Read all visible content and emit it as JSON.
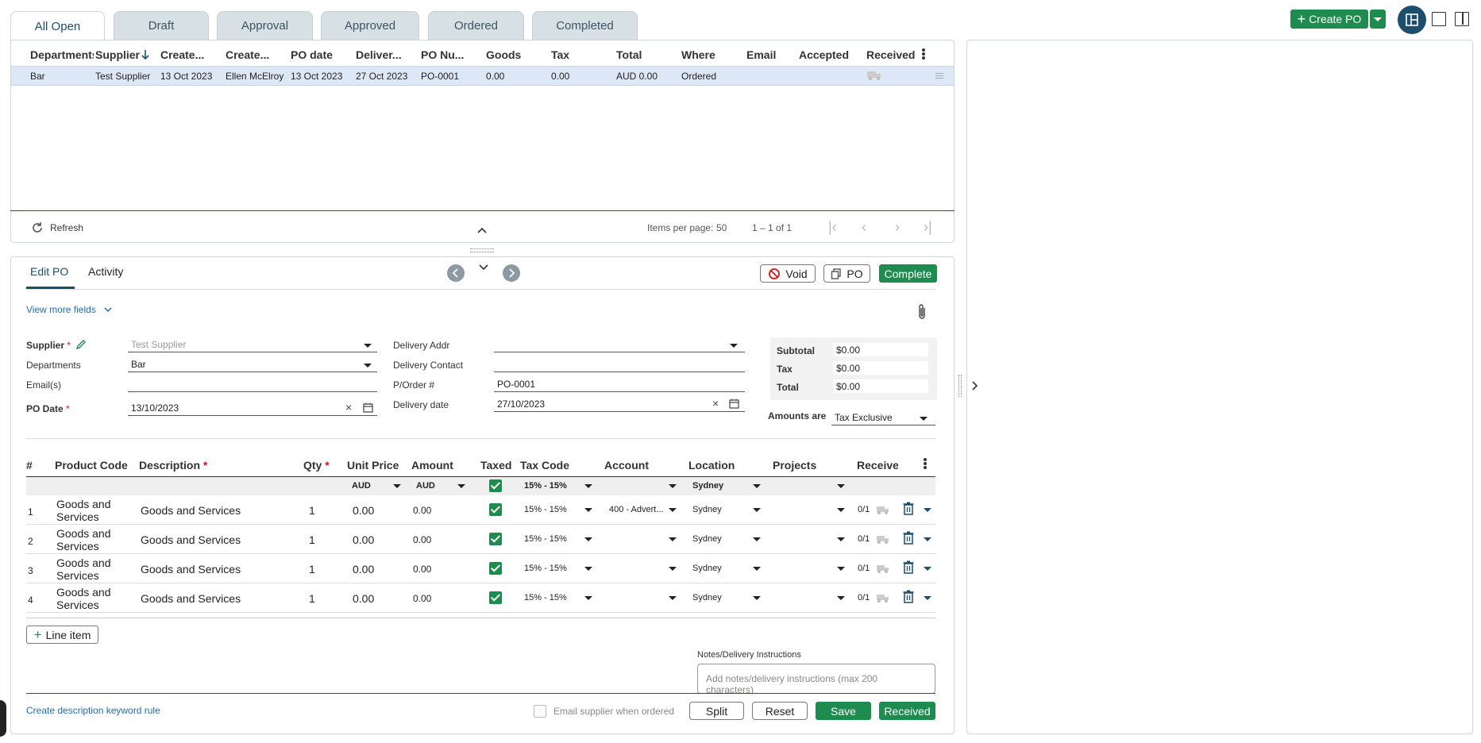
{
  "tabs": [
    "All Open",
    "Draft",
    "Approval",
    "Approved",
    "Ordered",
    "Completed"
  ],
  "toolbar": {
    "create_po": "Create PO"
  },
  "list": {
    "headers": [
      "Departments",
      "Supplier",
      "Create...",
      "Create...",
      "PO date",
      "Deliver...",
      "PO Nu...",
      "Goods",
      "Tax",
      "Total",
      "Where",
      "Email",
      "Accepted",
      "Received"
    ],
    "rows": [
      [
        "Bar",
        "Test Supplier",
        "13 Oct 2023",
        "Ellen McElroy",
        "13 Oct 2023",
        "27 Oct 2023",
        "PO-0001",
        "0.00",
        "0.00",
        "AUD 0.00",
        "Ordered",
        "",
        "",
        ""
      ]
    ],
    "refresh": "Refresh",
    "items_per_page_label": "Items per page:",
    "items_per_page": "50",
    "range": "1 – 1 of 1"
  },
  "edit": {
    "tabs": [
      "Edit PO",
      "Activity"
    ],
    "void": "Void",
    "po": "PO",
    "complete": "Complete",
    "view_more": "View more fields",
    "supplier_label": "Supplier",
    "supplier_value": "Test Supplier",
    "departments_label": "Departments",
    "departments_value": "Bar",
    "emails_label": "Email(s)",
    "po_date_label": "PO Date",
    "po_date_value": "13/10/2023",
    "delivery_addr_label": "Delivery Addr",
    "delivery_contact_label": "Delivery Contact",
    "porder_label": "P/Order #",
    "porder_value": "PO-0001",
    "delivery_date_label": "Delivery date",
    "delivery_date_value": "27/10/2023",
    "subtotal_label": "Subtotal",
    "subtotal": "$0.00",
    "tax_label": "Tax",
    "tax": "$0.00",
    "total_label": "Total",
    "total": "$0.00",
    "amounts_are_label": "Amounts are",
    "amounts_are": "Tax Exclusive"
  },
  "lines": {
    "headers": [
      "#",
      "Product Code",
      "Description",
      "Qty",
      "Unit Price",
      "Amount",
      "Taxed",
      "Tax Code",
      "Account",
      "Location",
      "Projects",
      "Receive"
    ],
    "defaults": {
      "unit_currency": "AUD",
      "amount_currency": "AUD",
      "tax_code": "15% - 15%",
      "location": "Sydney"
    },
    "rows": [
      {
        "n": "1",
        "product": "Goods and Services",
        "desc": "Goods and Services",
        "qty": "1",
        "unit": "0.00",
        "amount": "0.00",
        "tax_code": "15% - 15%",
        "account": "400 - Advert...",
        "location": "Sydney",
        "received": "0/1"
      },
      {
        "n": "2",
        "product": "Goods and Services",
        "desc": "Goods and Services",
        "qty": "1",
        "unit": "0.00",
        "amount": "0.00",
        "tax_code": "15% - 15%",
        "account": "",
        "location": "Sydney",
        "received": "0/1"
      },
      {
        "n": "3",
        "product": "Goods and Services",
        "desc": "Goods and Services",
        "qty": "1",
        "unit": "0.00",
        "amount": "0.00",
        "tax_code": "15% - 15%",
        "account": "",
        "location": "Sydney",
        "received": "0/1"
      },
      {
        "n": "4",
        "product": "Goods and Services",
        "desc": "Goods and Services",
        "qty": "1",
        "unit": "0.00",
        "amount": "0.00",
        "tax_code": "15% - 15%",
        "account": "",
        "location": "Sydney",
        "received": "0/1"
      }
    ],
    "add_line": "Line item"
  },
  "notes": {
    "label": "Notes/Delivery Instructions",
    "placeholder": "Add notes/delivery instructions (max 200 characters)"
  },
  "footer": {
    "keyword_rule": "Create description keyword rule",
    "email_supplier": "Email supplier when ordered",
    "split": "Split",
    "reset": "Reset",
    "save": "Save",
    "received": "Received"
  },
  "colors": {
    "accent_green": "#1e8c4e",
    "link_blue": "#1e6db6",
    "tab_bg": "#d7e0e4",
    "row_selected": "#dde8f6"
  }
}
